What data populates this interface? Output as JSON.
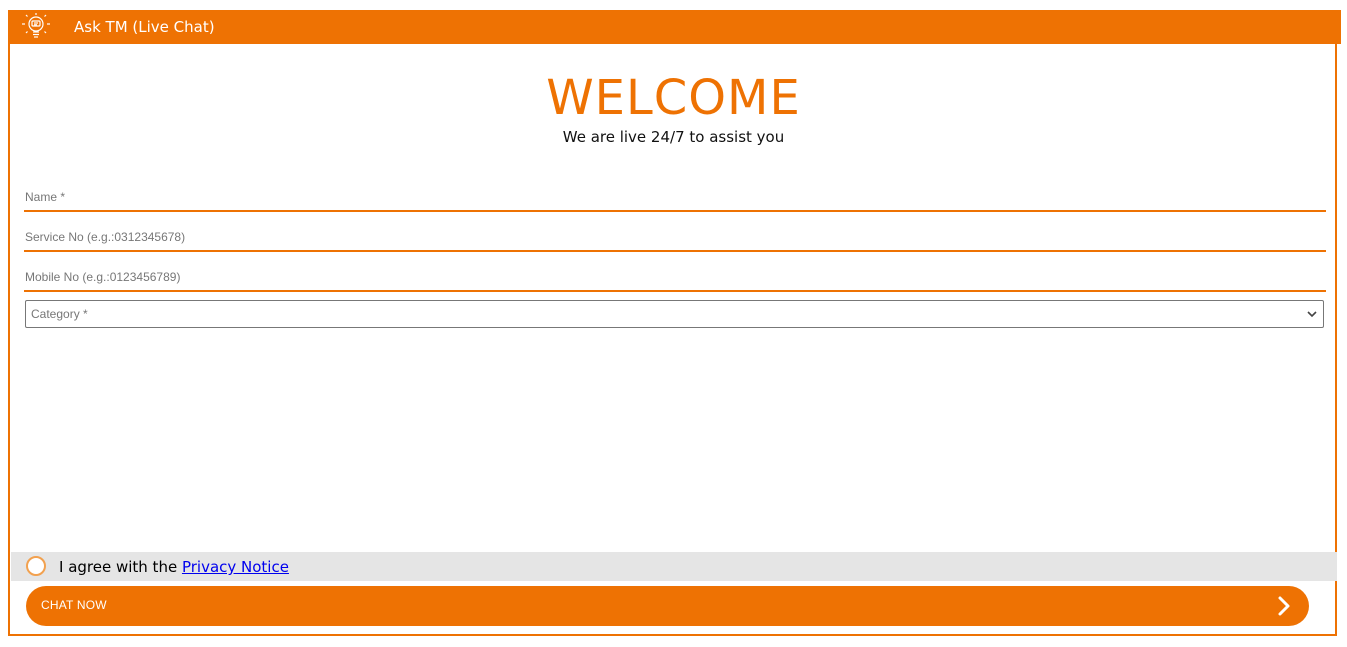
{
  "header": {
    "title": "Ask TM (Live Chat)",
    "logo_icon": "lightbulb-chat-icon",
    "background": "#EE7203"
  },
  "welcome": {
    "heading": "WELCOME",
    "subtitle": "We are live 24/7 to assist you"
  },
  "form": {
    "name_placeholder": "Name *",
    "service_no_placeholder": "Service No (e.g.:0312345678)",
    "mobile_no_placeholder": "Mobile No (e.g.:0123456789)",
    "category": {
      "selected": "Category *",
      "icon": "chevron-down-icon"
    }
  },
  "agreement": {
    "text": "I agree with the ",
    "link_text": "Privacy Notice"
  },
  "chat_button": {
    "label": "CHAT NOW",
    "icon": "chevron-right-icon"
  },
  "colors": {
    "accent": "#EE7203",
    "link": "#0000EE",
    "agree_bar_bg": "#E5E5E5"
  }
}
